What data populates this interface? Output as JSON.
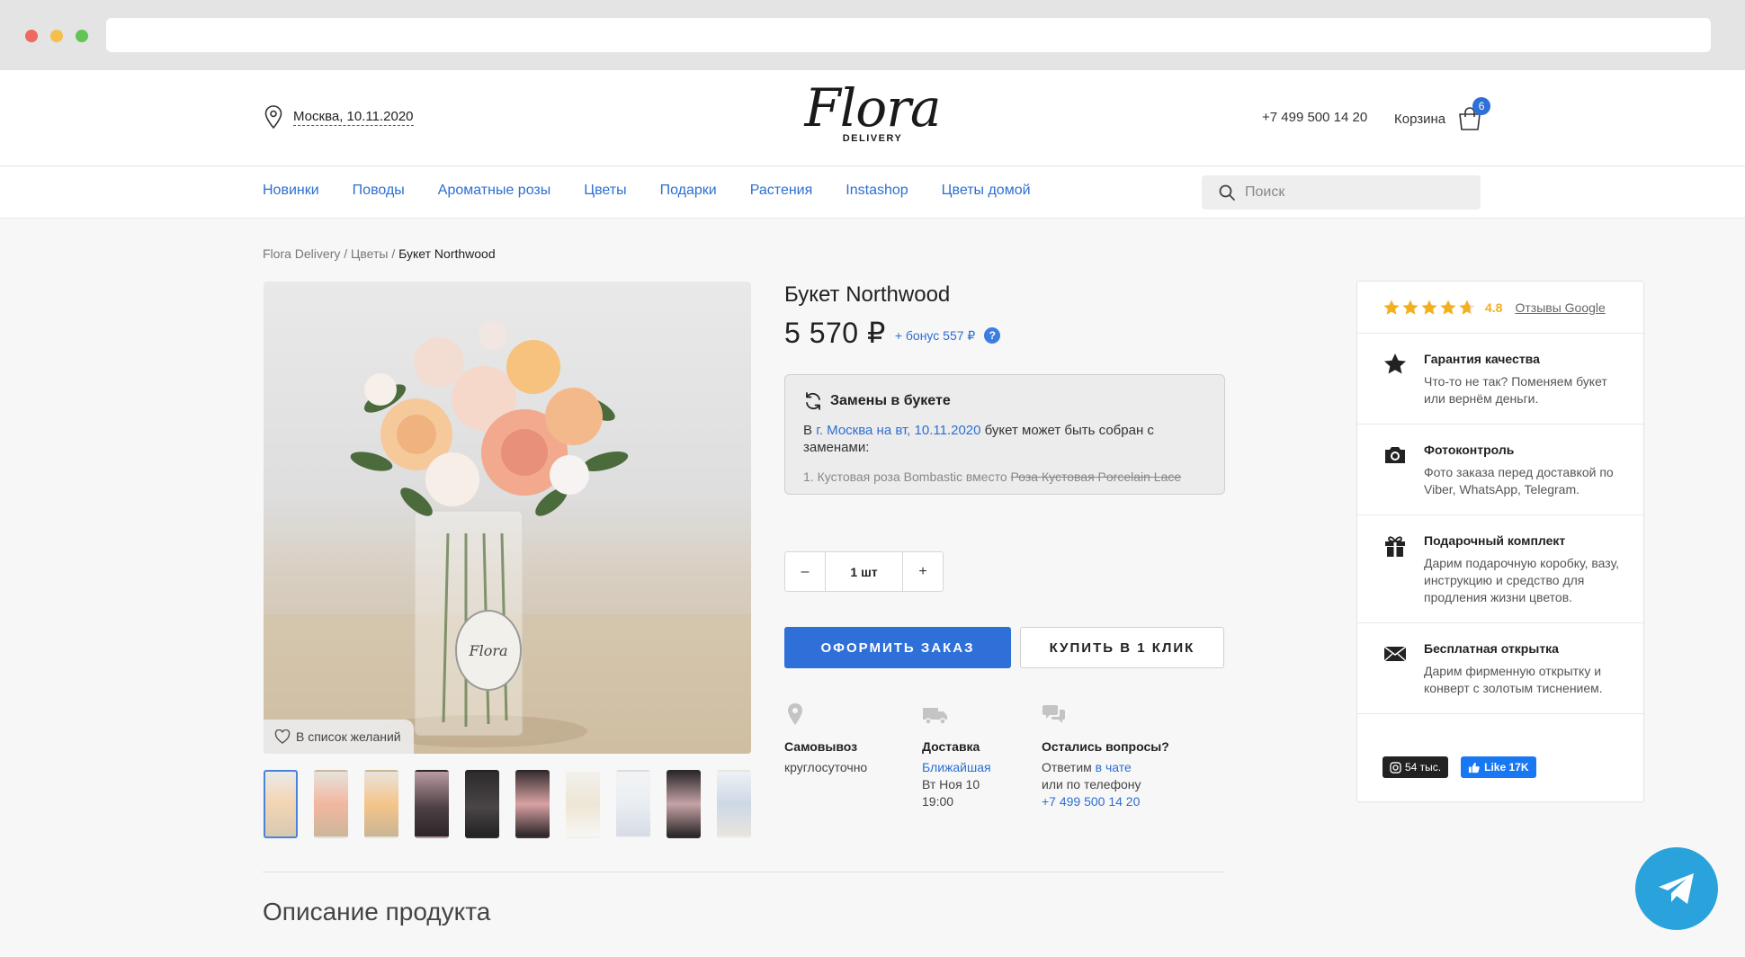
{
  "header": {
    "location": "Москва, 10.11.2020",
    "logo_script": "Flora",
    "logo_sub": "DELIVERY",
    "phone": "+7 499 500 14 20",
    "cart_label": "Корзина",
    "cart_count": "6"
  },
  "nav": {
    "items": [
      "Новинки",
      "Поводы",
      "Ароматные розы",
      "Цветы",
      "Подарки",
      "Растения",
      "Instashop",
      "Цветы домой"
    ],
    "search_placeholder": "Поиск"
  },
  "breadcrumb": {
    "root": "Flora Delivery",
    "sep1": " / ",
    "category": "Цветы",
    "sep2": " / ",
    "current": "Букет Northwood"
  },
  "product": {
    "title": "Букет Northwood",
    "price": "5 570 ₽",
    "bonus": "+ бонус 557 ₽",
    "bonus_help": "?",
    "wishlist_label": "В список желаний",
    "thumbnail_count": 10,
    "active_thumbnail": 1
  },
  "substitution": {
    "heading": "Замены в букете",
    "text_prefix": "В ",
    "text_link": "г. Москва на вт, 10.11.2020",
    "text_suffix": " букет может быть собран с заменами:",
    "item_prefix": "1. Кустовая роза Bombastic вместо ",
    "item_strike": "Роза Кустовая Porcelain Lace"
  },
  "quantity": {
    "minus": "–",
    "value": "1 шт",
    "plus": "+"
  },
  "buttons": {
    "order": "ОФОРМИТЬ ЗАКАЗ",
    "one_click": "КУПИТЬ В 1 КЛИК"
  },
  "delivery_info": {
    "pickup": {
      "title": "Самовывоз",
      "line1": "круглосуточно"
    },
    "delivery": {
      "title": "Доставка",
      "link": "Ближайшая",
      "line2": "Вт Ноя 10",
      "line3": "19:00"
    },
    "questions": {
      "title": "Остались вопросы?",
      "line1_prefix": "Ответим ",
      "line1_link": "в чате",
      "line2": "или по телефону",
      "phone": "+7 499 500 14 20"
    }
  },
  "description_heading": "Описание продукта",
  "side_panel": {
    "rating_value": "4.8",
    "rating_link": "Отзывы Google",
    "features": [
      {
        "icon": "star-icon",
        "title": "Гарантия качества",
        "text": "Что-то не так? Поменяем букет или вернём деньги."
      },
      {
        "icon": "camera-icon",
        "title": "Фотоконтроль",
        "text": "Фото заказа перед доставкой по Viber, WhatsApp, Telegram."
      },
      {
        "icon": "gift-icon",
        "title": "Подарочный комплект",
        "text": "Дарим подарочную коробку, вазу, инструкцию и средство для продления жизни цветов."
      },
      {
        "icon": "envelope-icon",
        "title": "Бесплатная открытка",
        "text": "Дарим фирменную открытку и конверт с золотым тиснением."
      }
    ],
    "instagram_count": "54 тыс.",
    "facebook_like": "Like 17K"
  },
  "colors": {
    "accent": "#2f6fd8",
    "link": "#2d6fd1",
    "star": "#f2b01e",
    "telegram": "#2aa3dc"
  }
}
